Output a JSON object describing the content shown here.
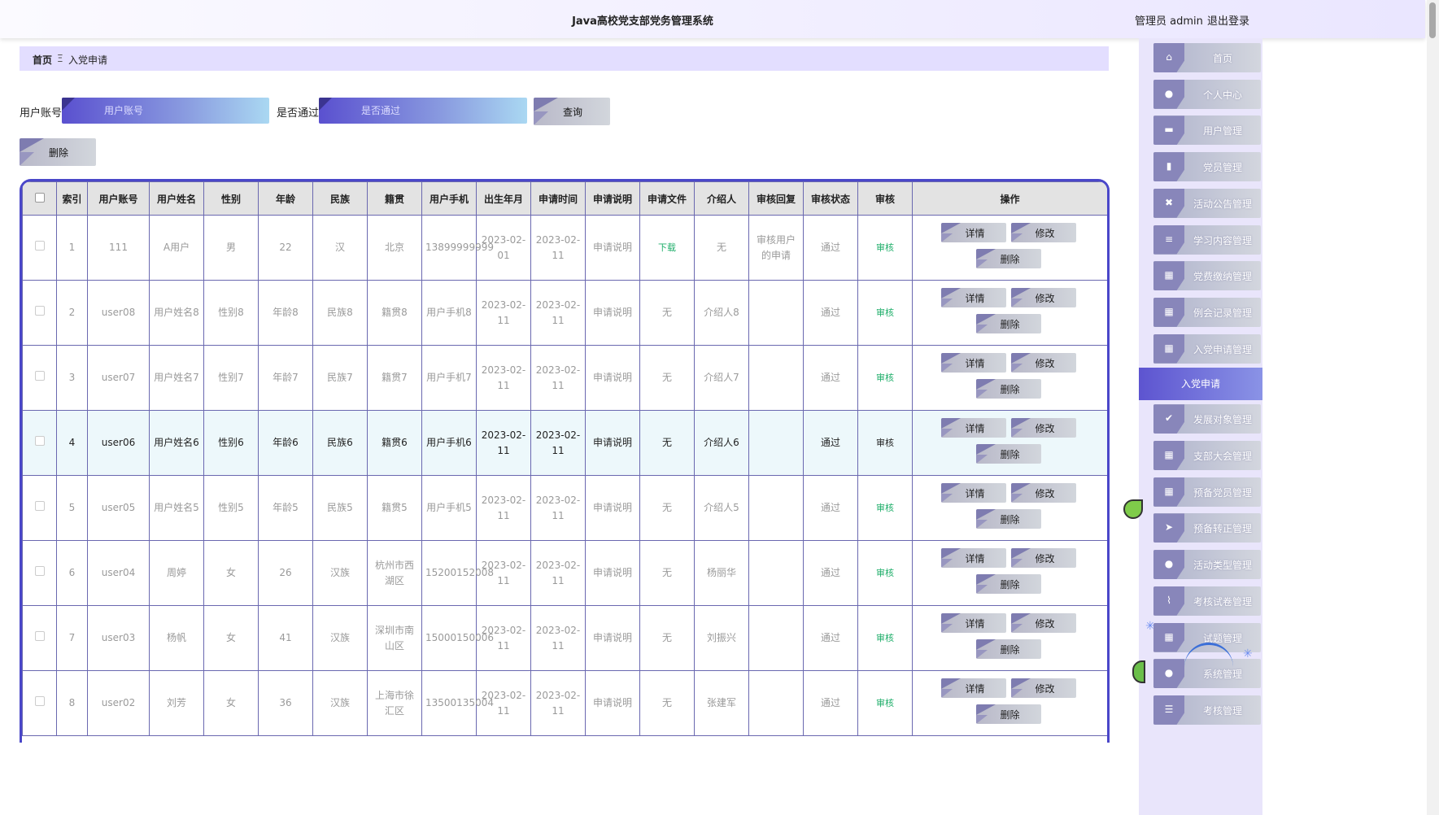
{
  "header": {
    "title": "Java高校党支部党务管理系统",
    "admin": "管理员 admin",
    "logout": "退出登录"
  },
  "breadcrumb": {
    "home": "首页",
    "sep": "Ξ",
    "current": "入党申请"
  },
  "search": {
    "account_label": "用户账号",
    "account_placeholder": "用户账号",
    "passed_label": "是否通过",
    "passed_placeholder": "是否通过",
    "query_button": "查询",
    "delete_button": "删除"
  },
  "table": {
    "headers": [
      "索引",
      "用户账号",
      "用户姓名",
      "性别",
      "年龄",
      "民族",
      "籍贯",
      "用户手机",
      "出生年月",
      "申请时间",
      "申请说明",
      "申请文件",
      "介绍人",
      "审核回复",
      "审核状态",
      "审核",
      "操作"
    ],
    "op_labels": {
      "detail": "详情",
      "modify": "修改",
      "delete": "删除"
    },
    "rows": [
      {
        "idx": "1",
        "account": "111",
        "name": "A用户",
        "gender": "男",
        "age": "22",
        "ethnic": "汉",
        "native": "北京",
        "phone": "13899999999",
        "birth": "2023-02-01",
        "apply_time": "2023-02-11",
        "desc": "申请说明",
        "file": "下载",
        "introducer": "无",
        "reply": "审核用户的申请",
        "status": "通过",
        "audit": "审核"
      },
      {
        "idx": "2",
        "account": "user08",
        "name": "用户姓名8",
        "gender": "性别8",
        "age": "年龄8",
        "ethnic": "民族8",
        "native": "籍贯8",
        "phone": "用户手机8",
        "birth": "2023-02-11",
        "apply_time": "2023-02-11",
        "desc": "申请说明",
        "file": "无",
        "introducer": "介绍人8",
        "reply": "",
        "status": "通过",
        "audit": "审核"
      },
      {
        "idx": "3",
        "account": "user07",
        "name": "用户姓名7",
        "gender": "性别7",
        "age": "年龄7",
        "ethnic": "民族7",
        "native": "籍贯7",
        "phone": "用户手机7",
        "birth": "2023-02-11",
        "apply_time": "2023-02-11",
        "desc": "申请说明",
        "file": "无",
        "introducer": "介绍人7",
        "reply": "",
        "status": "通过",
        "audit": "审核"
      },
      {
        "idx": "4",
        "account": "user06",
        "name": "用户姓名6",
        "gender": "性别6",
        "age": "年龄6",
        "ethnic": "民族6",
        "native": "籍贯6",
        "phone": "用户手机6",
        "birth": "2023-02-11",
        "apply_time": "2023-02-11",
        "desc": "申请说明",
        "file": "无",
        "introducer": "介绍人6",
        "reply": "",
        "status": "通过",
        "audit": "审核"
      },
      {
        "idx": "5",
        "account": "user05",
        "name": "用户姓名5",
        "gender": "性别5",
        "age": "年龄5",
        "ethnic": "民族5",
        "native": "籍贯5",
        "phone": "用户手机5",
        "birth": "2023-02-11",
        "apply_time": "2023-02-11",
        "desc": "申请说明",
        "file": "无",
        "introducer": "介绍人5",
        "reply": "",
        "status": "通过",
        "audit": "审核"
      },
      {
        "idx": "6",
        "account": "user04",
        "name": "周婷",
        "gender": "女",
        "age": "26",
        "ethnic": "汉族",
        "native": "杭州市西湖区",
        "phone": "15200152008",
        "birth": "2023-02-11",
        "apply_time": "2023-02-11",
        "desc": "申请说明",
        "file": "无",
        "introducer": "杨丽华",
        "reply": "",
        "status": "通过",
        "audit": "审核"
      },
      {
        "idx": "7",
        "account": "user03",
        "name": "杨帆",
        "gender": "女",
        "age": "41",
        "ethnic": "汉族",
        "native": "深圳市南山区",
        "phone": "15000150006",
        "birth": "2023-02-11",
        "apply_time": "2023-02-11",
        "desc": "申请说明",
        "file": "无",
        "introducer": "刘振兴",
        "reply": "",
        "status": "通过",
        "audit": "审核"
      },
      {
        "idx": "8",
        "account": "user02",
        "name": "刘芳",
        "gender": "女",
        "age": "36",
        "ethnic": "汉族",
        "native": "上海市徐汇区",
        "phone": "13500135004",
        "birth": "2023-02-11",
        "apply_time": "2023-02-11",
        "desc": "申请说明",
        "file": "无",
        "introducer": "张建军",
        "reply": "",
        "status": "通过",
        "audit": "审核"
      }
    ]
  },
  "sidebar": {
    "items": [
      {
        "label": "首页",
        "icon": "home-icon",
        "glyph": "⌂"
      },
      {
        "label": "个人中心",
        "icon": "user-icon",
        "glyph": "●"
      },
      {
        "label": "用户管理",
        "icon": "monitor-icon",
        "glyph": "▬"
      },
      {
        "label": "党员管理",
        "icon": "book-icon",
        "glyph": "▮"
      },
      {
        "label": "活动公告管理",
        "icon": "clipboard-x-icon",
        "glyph": "✖"
      },
      {
        "label": "学习内容管理",
        "icon": "clipboard-icon",
        "glyph": "≡"
      },
      {
        "label": "党费缴纳管理",
        "icon": "grid-icon",
        "glyph": "▦"
      },
      {
        "label": "例会记录管理",
        "icon": "grid-icon",
        "glyph": "▦"
      },
      {
        "label": "入党申请管理",
        "icon": "grid-icon",
        "glyph": "▦"
      },
      {
        "label": "入党申请",
        "active": true
      },
      {
        "label": "发展对象管理",
        "icon": "clipboard-check-icon",
        "glyph": "✔"
      },
      {
        "label": "支部大会管理",
        "icon": "grid-icon",
        "glyph": "▦"
      },
      {
        "label": "预备党员管理",
        "icon": "grid-icon",
        "glyph": "▦"
      },
      {
        "label": "预备转正管理",
        "icon": "send-icon",
        "glyph": "➤"
      },
      {
        "label": "活动类型管理",
        "icon": "user-icon",
        "glyph": "●"
      },
      {
        "label": "考核试卷管理",
        "icon": "chart-icon",
        "glyph": "⌇"
      },
      {
        "label": "试题管理",
        "icon": "grid-icon",
        "glyph": "▦"
      },
      {
        "label": "系统管理",
        "icon": "user-icon",
        "glyph": "●"
      },
      {
        "label": "考核管理",
        "icon": "list-icon",
        "glyph": "☰"
      }
    ]
  },
  "colors": {
    "accent": "#4a47c9",
    "sidebar_bg": "#e9e5fb",
    "breadcrumb_bg": "#e3deff",
    "green": "#1fae6a"
  }
}
